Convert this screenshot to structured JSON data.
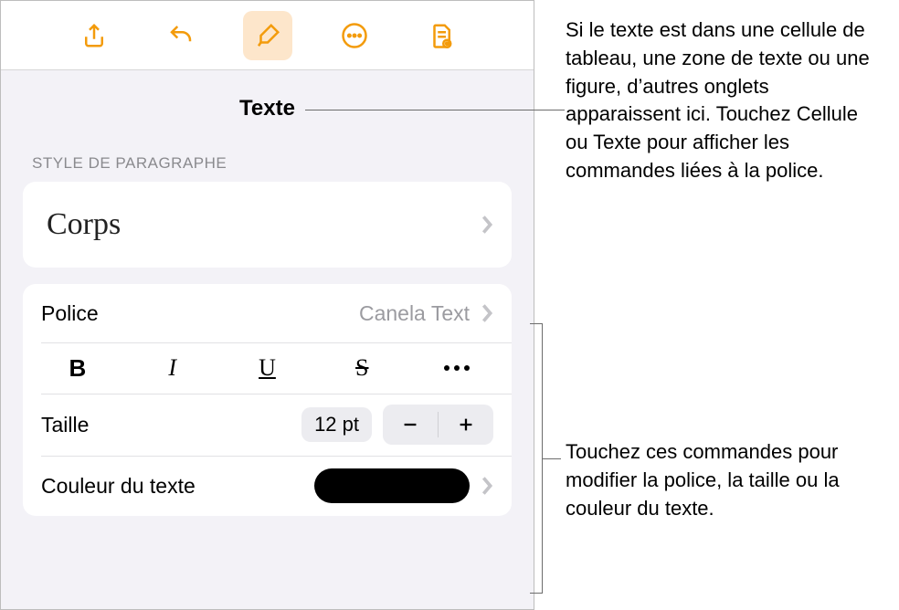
{
  "toolbar": {
    "share": "share-icon",
    "undo": "undo-icon",
    "format": "brush-icon",
    "more": "more-icon",
    "doc": "doc-icon"
  },
  "tab": {
    "title": "Texte"
  },
  "paragraph": {
    "section_label": "STYLE DE PARAGRAPHE",
    "style_name": "Corps"
  },
  "font": {
    "label": "Police",
    "value": "Canela Text",
    "bold": "B",
    "italic": "I",
    "underline": "U",
    "strike": "S"
  },
  "size": {
    "label": "Taille",
    "value": "12 pt"
  },
  "text_color": {
    "label": "Couleur du texte",
    "value": "#000000"
  },
  "annotations": {
    "a1": "Si le texte est dans une cellule de tableau, une zone de texte ou une figure, d’autres onglets apparaissent ici. Touchez Cellule ou Texte pour afficher les commandes liées à la police.",
    "a2": "Touchez ces commandes pour modifier la police, la taille ou la couleur du texte."
  }
}
